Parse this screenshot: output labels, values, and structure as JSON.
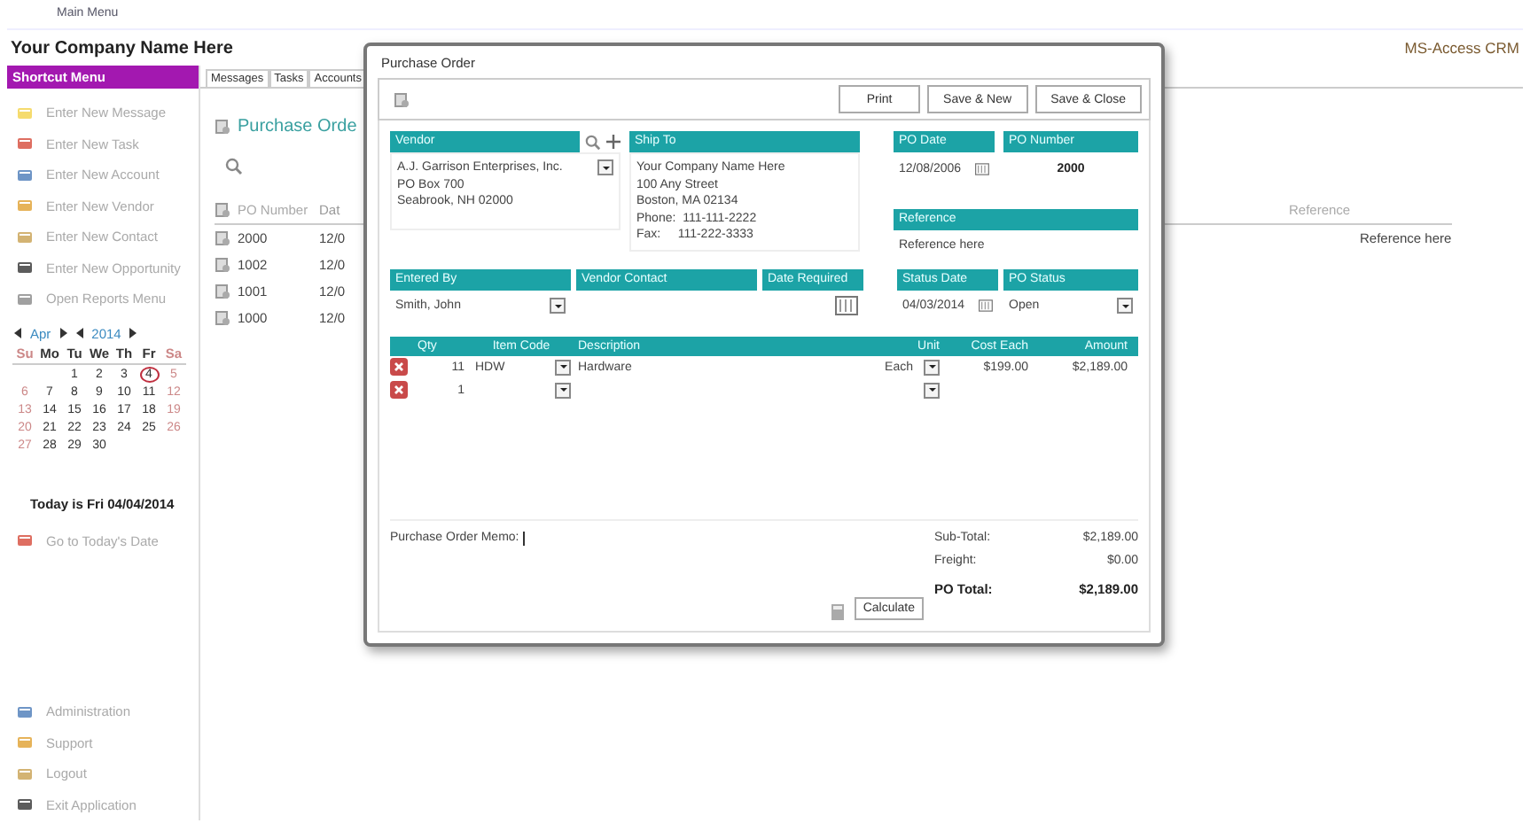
{
  "app": {
    "menu_title": "Main Menu",
    "company": "Your Company Name Here",
    "product": "MS-Access CRM"
  },
  "sidebar": {
    "title": "Shortcut Menu",
    "items": [
      "Enter New Message",
      "Enter New Task",
      "Enter New Account",
      "Enter New Vendor",
      "Enter New Contact",
      "Enter New Opportunity",
      "Open Reports Menu"
    ],
    "calendar": {
      "month": "Apr",
      "year": "2014",
      "weekdays": [
        "Su",
        "Mo",
        "Tu",
        "We",
        "Th",
        "Fr",
        "Sa"
      ],
      "weeks": [
        [
          {
            "label": "1",
            "selected": false
          },
          {
            "label": "2",
            "selected": false
          },
          {
            "label": "3",
            "selected": false
          },
          {
            "label": "4",
            "selected": true
          },
          {
            "label": "5",
            "selected": false
          }
        ],
        [
          {
            "label": "6",
            "selected": false
          },
          {
            "label": "7",
            "selected": false
          },
          {
            "label": "8",
            "selected": false
          },
          {
            "label": "9",
            "selected": false
          },
          {
            "label": "10",
            "selected": false
          },
          {
            "label": "11",
            "selected": false
          },
          {
            "label": "12",
            "selected": false
          }
        ],
        [
          {
            "label": "13",
            "selected": false
          },
          {
            "label": "14",
            "selected": false
          },
          {
            "label": "15",
            "selected": false
          },
          {
            "label": "16",
            "selected": false
          },
          {
            "label": "17",
            "selected": false
          },
          {
            "label": "18",
            "selected": false
          },
          {
            "label": "19",
            "selected": false
          }
        ],
        [
          {
            "label": "20",
            "selected": false
          },
          {
            "label": "21",
            "selected": false
          },
          {
            "label": "22",
            "selected": false
          },
          {
            "label": "23",
            "selected": false
          },
          {
            "label": "24",
            "selected": false
          },
          {
            "label": "25",
            "selected": false
          },
          {
            "label": "26",
            "selected": false
          }
        ],
        [
          {
            "label": "27",
            "selected": false
          },
          {
            "label": "28",
            "selected": false
          },
          {
            "label": "29",
            "selected": false
          },
          {
            "label": "30",
            "selected": false
          }
        ]
      ]
    },
    "today": "Today is Fri 04/04/2014",
    "goto_today": "Go to Today's Date",
    "bottom_items": [
      "Administration",
      "Support",
      "Logout",
      "Exit Application"
    ]
  },
  "tabs": [
    "Messages",
    "Tasks",
    "Accounts"
  ],
  "main": {
    "title": "Purchase Orde",
    "columns": [
      "PO Number",
      "Dat"
    ],
    "reference_column": "Reference",
    "rows": [
      {
        "po": "2000",
        "date": "12/0",
        "reference": "Reference here"
      },
      {
        "po": "1002",
        "date": "12/0"
      },
      {
        "po": "1001",
        "date": "12/0"
      },
      {
        "po": "1000",
        "date": "12/0"
      }
    ]
  },
  "dialog": {
    "title": "Purchase Order",
    "buttons": [
      "Print",
      "Save & New",
      "Save & Close"
    ],
    "vendor": {
      "label": "Vendor",
      "lines": [
        "A.J. Garrison Enterprises, Inc.",
        "PO Box 700",
        "Seabrook, NH 02000"
      ]
    },
    "ship_to": {
      "label": "Ship To",
      "lines": [
        "Your Company Name Here",
        "100 Any Street",
        "Boston, MA 02134",
        "Phone:  111-111-2222",
        "Fax:     111-222-3333"
      ]
    },
    "po_date": {
      "label": "PO Date",
      "value": "12/08/2006"
    },
    "po_number": {
      "label": "PO Number",
      "value": "2000"
    },
    "reference": {
      "label": "Reference",
      "value": "Reference here"
    },
    "entered_by": {
      "label": "Entered By",
      "value": "Smith, John"
    },
    "vendor_contact": {
      "label": "Vendor Contact"
    },
    "date_required": {
      "label": "Date Required"
    },
    "status_date": {
      "label": "Status Date",
      "value": "04/03/2014"
    },
    "po_status": {
      "label": "PO Status",
      "value": "Open"
    },
    "line_columns": [
      "Qty",
      "Item Code",
      "Description",
      "Unit",
      "Cost Each",
      "Amount"
    ],
    "lines": [
      {
        "qty": "11",
        "item_code": "HDW",
        "description": "Hardware",
        "unit": "Each",
        "cost_each": "$199.00",
        "amount": "$2,189.00"
      },
      {
        "qty": "1"
      }
    ],
    "memo_label": "Purchase Order Memo:",
    "totals": [
      {
        "label": "Sub-Total:",
        "value": "$2,189.00",
        "kind": "normal"
      },
      {
        "label": "Freight:",
        "value": "$0.00",
        "kind": "normal"
      },
      {
        "label": "PO Total:",
        "value": "$2,189.00",
        "kind": "total"
      }
    ],
    "calculate": "Calculate"
  }
}
